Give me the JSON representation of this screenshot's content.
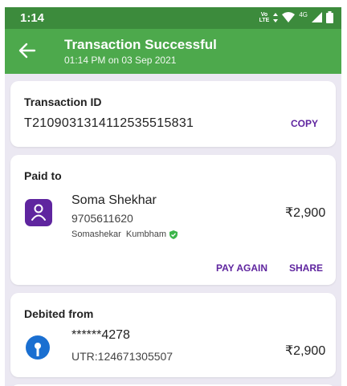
{
  "status_bar": {
    "time": "1:14",
    "volte_top": "Vo",
    "volte_bottom": "LTE",
    "network": "4G"
  },
  "header": {
    "title": "Transaction Successful",
    "subtitle": "01:14 PM on 03 Sep 2021"
  },
  "transaction": {
    "label": "Transaction ID",
    "id": "T2109031314112535515831",
    "copy_label": "COPY"
  },
  "paid_to": {
    "label": "Paid to",
    "name": "Soma Shekhar",
    "phone": "9705611620",
    "verified_name": "Somashekar  Kumbham",
    "amount": "₹2,900",
    "pay_again_label": "PAY AGAIN",
    "share_label": "SHARE"
  },
  "debited_from": {
    "label": "Debited from",
    "account": "******4278",
    "utr": "UTR:124671305507",
    "amount": "₹2,900"
  },
  "colors": {
    "status_bar": "#3c8b3c",
    "app_bar": "#4da94c",
    "accent_purple": "#5f259f",
    "background": "#ebe8f2",
    "verified_green": "#3bb54a",
    "bank_blue": "#1a6fd1"
  }
}
